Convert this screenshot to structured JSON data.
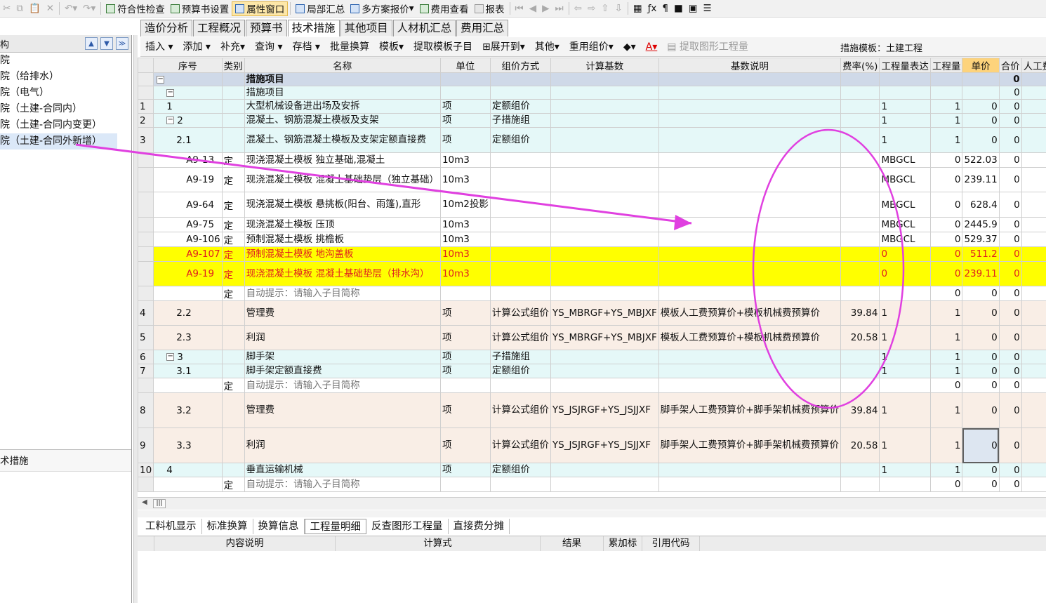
{
  "toolbar": {
    "items": [
      "符合性检查",
      "预算书设置",
      "属性窗口",
      "局部汇总",
      "多方案报价",
      "费用查看",
      "报表"
    ]
  },
  "left_panel": {
    "header": "构",
    "items": [
      "院",
      "院（给排水）",
      "院（电气）",
      "院（土建-合同内）",
      "院（土建-合同内变更）",
      "院（土建-合同外新增）"
    ],
    "bottom_label": "术措施"
  },
  "tabs": [
    "造价分析",
    "工程概况",
    "预算书",
    "技术措施",
    "其他项目",
    "人材机汇总",
    "费用汇总"
  ],
  "sub_toolbar": {
    "items": [
      "插入",
      "添加",
      "补充",
      "查询",
      "存档",
      "批量换算",
      "模板",
      "提取模板子目",
      "展开到",
      "其他",
      "重用组价",
      "提取图形工程量"
    ],
    "template_label": "措施模板：土建工程"
  },
  "columns": [
    "序号",
    "类别",
    "名称",
    "单位",
    "组价方式",
    "计算基数",
    "基数说明",
    "费率(%)",
    "工程量表达",
    "工程量",
    "单价",
    "合价",
    "人工费合"
  ],
  "rows": [
    {
      "rn": "",
      "seq": "",
      "cat": "",
      "name": "措施项目",
      "unit": "",
      "method": "",
      "base": "",
      "desc": "",
      "rate": "",
      "expr": "",
      "qty": "",
      "price": "",
      "total": "0",
      "labor": "",
      "style": "bg0"
    },
    {
      "rn": "",
      "seq": "",
      "cat": "",
      "name": "措施项目",
      "unit": "",
      "method": "",
      "base": "",
      "desc": "",
      "rate": "",
      "expr": "",
      "qty": "",
      "price": "",
      "total": "0",
      "labor": "",
      "style": "bg1"
    },
    {
      "rn": "1",
      "seq": "1",
      "cat": "",
      "name": "大型机械设备进出场及安拆",
      "unit": "项",
      "method": "定额组价",
      "base": "",
      "desc": "",
      "rate": "",
      "expr": "1",
      "qty": "1",
      "price": "0",
      "total": "0",
      "labor": "",
      "style": "bg1"
    },
    {
      "rn": "2",
      "seq": "2",
      "cat": "",
      "name": "混凝土、钢筋混凝土模板及支架",
      "unit": "项",
      "method": "子措施组",
      "base": "",
      "desc": "",
      "rate": "",
      "expr": "1",
      "qty": "1",
      "price": "0",
      "total": "0",
      "labor": "",
      "style": "bg1"
    },
    {
      "rn": "3",
      "seq": "2.1",
      "cat": "",
      "name": "混凝土、钢筋混凝土模板及支架定额直接费",
      "unit": "项",
      "method": "定额组价",
      "base": "",
      "desc": "",
      "rate": "",
      "expr": "1",
      "qty": "1",
      "price": "0",
      "total": "0",
      "labor": "",
      "style": "bg1"
    },
    {
      "rn": "",
      "seq": "A9-13",
      "cat": "定",
      "name": "现浇混凝土模板 独立基础,混凝土",
      "unit": "10m3",
      "method": "",
      "base": "",
      "desc": "",
      "rate": "",
      "expr": "MBGCL",
      "qty": "0",
      "price": "522.03",
      "total": "0",
      "labor": "",
      "style": "bgw"
    },
    {
      "rn": "",
      "seq": "A9-19",
      "cat": "定",
      "name": "现浇混凝土模板 混凝土基础垫层（独立基础）",
      "unit": "10m3",
      "method": "",
      "base": "",
      "desc": "",
      "rate": "",
      "expr": "MBGCL",
      "qty": "0",
      "price": "239.11",
      "total": "0",
      "labor": "",
      "style": "bgw"
    },
    {
      "rn": "",
      "seq": "A9-64",
      "cat": "定",
      "name": "现浇混凝土模板 悬挑板(阳台、雨篷),直形",
      "unit": "10m2投影",
      "method": "",
      "base": "",
      "desc": "",
      "rate": "",
      "expr": "MBGCL",
      "qty": "0",
      "price": "628.4",
      "total": "0",
      "labor": "",
      "style": "bgw"
    },
    {
      "rn": "",
      "seq": "A9-75",
      "cat": "定",
      "name": "现浇混凝土模板 压顶",
      "unit": "10m3",
      "method": "",
      "base": "",
      "desc": "",
      "rate": "",
      "expr": "MBGCL",
      "qty": "0",
      "price": "2445.9",
      "total": "0",
      "labor": "",
      "style": "bgw"
    },
    {
      "rn": "",
      "seq": "A9-106",
      "cat": "定",
      "name": "预制混凝土模板 挑檐板",
      "unit": "10m3",
      "method": "",
      "base": "",
      "desc": "",
      "rate": "",
      "expr": "MBGCL",
      "qty": "0",
      "price": "529.37",
      "total": "0",
      "labor": "",
      "style": "bgw"
    },
    {
      "rn": "",
      "seq": "A9-107",
      "cat": "定",
      "name": "预制混凝土模板 地沟盖板",
      "unit": "10m3",
      "method": "",
      "base": "",
      "desc": "",
      "rate": "",
      "expr": "0",
      "qty": "0",
      "price": "511.2",
      "total": "0",
      "labor": "",
      "style": "bgy"
    },
    {
      "rn": "",
      "seq": "A9-19",
      "cat": "定",
      "name": "现浇混凝土模板 混凝土基础垫层（排水沟）",
      "unit": "10m3",
      "method": "",
      "base": "",
      "desc": "",
      "rate": "",
      "expr": "0",
      "qty": "0",
      "price": "239.11",
      "total": "0",
      "labor": "",
      "style": "bgy"
    },
    {
      "rn": "",
      "seq": "",
      "cat": "定",
      "name": "自动提示：请输入子目简称",
      "unit": "",
      "method": "",
      "base": "",
      "desc": "",
      "rate": "",
      "expr": "",
      "qty": "0",
      "price": "0",
      "total": "0",
      "labor": "",
      "style": "bgw"
    },
    {
      "rn": "4",
      "seq": "2.2",
      "cat": "",
      "name": "管理费",
      "unit": "项",
      "method": "计算公式组价",
      "base": "YS_MBRGF+YS_MBJXF",
      "desc": "模板人工费预算价+模板机械费预算价",
      "rate": "39.84",
      "expr": "1",
      "qty": "1",
      "price": "0",
      "total": "0",
      "labor": "",
      "style": "bgq"
    },
    {
      "rn": "5",
      "seq": "2.3",
      "cat": "",
      "name": "利润",
      "unit": "项",
      "method": "计算公式组价",
      "base": "YS_MBRGF+YS_MBJXF",
      "desc": "模板人工费预算价+模板机械费预算价",
      "rate": "20.58",
      "expr": "1",
      "qty": "1",
      "price": "0",
      "total": "0",
      "labor": "",
      "style": "bgq"
    },
    {
      "rn": "6",
      "seq": "3",
      "cat": "",
      "name": "脚手架",
      "unit": "项",
      "method": "子措施组",
      "base": "",
      "desc": "",
      "rate": "",
      "expr": "1",
      "qty": "1",
      "price": "0",
      "total": "0",
      "labor": "",
      "style": "bg1"
    },
    {
      "rn": "7",
      "seq": "3.1",
      "cat": "",
      "name": "脚手架定额直接费",
      "unit": "项",
      "method": "定额组价",
      "base": "",
      "desc": "",
      "rate": "",
      "expr": "1",
      "qty": "1",
      "price": "0",
      "total": "0",
      "labor": "",
      "style": "bg1"
    },
    {
      "rn": "",
      "seq": "",
      "cat": "定",
      "name": "自动提示：请输入子目简称",
      "unit": "",
      "method": "",
      "base": "",
      "desc": "",
      "rate": "",
      "expr": "",
      "qty": "0",
      "price": "0",
      "total": "0",
      "labor": "",
      "style": "bgw"
    },
    {
      "rn": "8",
      "seq": "3.2",
      "cat": "",
      "name": "管理费",
      "unit": "项",
      "method": "计算公式组价",
      "base": "YS_JSJRGF+YS_JSJJXF",
      "desc": "脚手架人工费预算价+脚手架机械费预算价",
      "rate": "39.84",
      "expr": "1",
      "qty": "1",
      "price": "0",
      "total": "0",
      "labor": "",
      "style": "bgq"
    },
    {
      "rn": "9",
      "seq": "3.3",
      "cat": "",
      "name": "利润",
      "unit": "项",
      "method": "计算公式组价",
      "base": "YS_JSJRGF+YS_JSJJXF",
      "desc": "脚手架人工费预算价+脚手架机械费预算价",
      "rate": "20.58",
      "expr": "1",
      "qty": "1",
      "price": "0",
      "total": "0",
      "labor": "",
      "style": "bgq"
    },
    {
      "rn": "10",
      "seq": "4",
      "cat": "",
      "name": "垂直运输机械",
      "unit": "项",
      "method": "定额组价",
      "base": "",
      "desc": "",
      "rate": "",
      "expr": "1",
      "qty": "1",
      "price": "0",
      "total": "0",
      "labor": "",
      "style": "bg1"
    },
    {
      "rn": "",
      "seq": "",
      "cat": "定",
      "name": "自动提示：请输入子目简称",
      "unit": "",
      "method": "",
      "base": "",
      "desc": "",
      "rate": "",
      "expr": "",
      "qty": "0",
      "price": "0",
      "total": "0",
      "labor": "",
      "style": "bgw"
    }
  ],
  "bottom_tabs": [
    "工料机显示",
    "标准换算",
    "换算信息",
    "工程量明细",
    "反查图形工程量",
    "直接费分摊"
  ],
  "bottom_columns": [
    "内容说明",
    "计算式",
    "结果",
    "累加标",
    "引用代码"
  ],
  "annotation_color": "#e040e0"
}
